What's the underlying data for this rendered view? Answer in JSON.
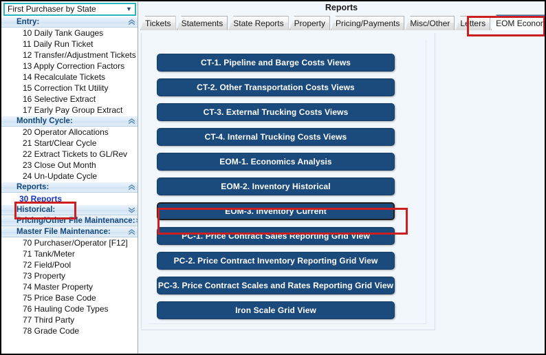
{
  "window": {
    "title": "Reports"
  },
  "sidebar": {
    "combo": {
      "value": "First Purchaser by State",
      "caret_icon": "chevron-down-icon"
    },
    "sections": [
      {
        "label": "Entry:",
        "expanded": true,
        "chevron_icon": "chevron-up-double-icon",
        "items": [
          "10 Daily Tank Gauges",
          "11 Daily Run Ticket",
          "12 Transfer/Adjustment Tickets",
          "13 Apply Correction Factors",
          "14 Recalculate Tickets",
          "15 Correction Tkt Utility",
          "16 Selective Extract",
          "17 Early Pay Group Extract"
        ]
      },
      {
        "label": "Monthly Cycle:",
        "expanded": true,
        "chevron_icon": "chevron-up-double-icon",
        "items": [
          "20 Operator Allocations",
          "21 Start/Clear Cycle",
          "22 Extract Tickets to GL/Rev",
          "23 Close Out Month",
          "24 Un-Update Cycle"
        ]
      },
      {
        "label": "Reports:",
        "expanded": true,
        "chevron_icon": "chevron-up-double-icon",
        "items": [],
        "link": "30 Reports"
      },
      {
        "label": "Historical:",
        "expanded": false,
        "chevron_icon": "chevron-down-double-icon",
        "items": []
      },
      {
        "label": "Pricing/Other File Maintenance:",
        "expanded": false,
        "chevron_icon": "chevron-down-double-icon",
        "items": []
      },
      {
        "label": "Master File Maintenance:",
        "expanded": true,
        "chevron_icon": "chevron-up-double-icon",
        "items": [
          "70 Purchaser/Operator  [F12]",
          "71 Tank/Meter",
          "72 Field/Pool",
          "73 Property",
          "74 Master Property",
          "75 Price Base Code",
          "76 Hauling Code Types",
          "77 Third Party",
          "78 Grade Code"
        ]
      }
    ]
  },
  "tabs": [
    {
      "label": "Tickets",
      "active": false
    },
    {
      "label": "Statements",
      "active": false
    },
    {
      "label": "State Reports",
      "active": false
    },
    {
      "label": "Property",
      "active": false
    },
    {
      "label": "Pricing/Payments",
      "active": false
    },
    {
      "label": "Misc/Other",
      "active": false
    },
    {
      "label": "Letters",
      "active": false
    },
    {
      "label": "EOM Economics",
      "active": true
    }
  ],
  "buttons": [
    {
      "label": "CT-1. Pipeline and Barge Costs Views",
      "focused": false
    },
    {
      "label": "CT-2. Other Transportation Costs Views",
      "focused": false
    },
    {
      "label": "CT-3. External Trucking Costs Views",
      "focused": false
    },
    {
      "label": "CT-4. Internal Trucking Costs Views",
      "focused": false
    },
    {
      "label": "EOM-1. Economics Analysis",
      "focused": false
    },
    {
      "label": "EOM-2. Inventory Historical",
      "focused": false
    },
    {
      "label": "EOM-3. Inventory Current",
      "focused": true
    },
    {
      "label": "PC-1. Price Contract Sales Reporting Grid View",
      "focused": false
    },
    {
      "label": "PC-2. Price Contract Inventory Reporting Grid View",
      "focused": false
    },
    {
      "label": "PC-3. Price Contract Scales and Rates Reporting Grid View",
      "focused": false
    },
    {
      "label": "Iron Scale Grid View",
      "focused": false
    }
  ],
  "annotations": {
    "highlight_color": "#cc1f1f",
    "boxes": [
      "30 Reports",
      "EOM Economics",
      "EOM-3. Inventory Current"
    ]
  },
  "colors": {
    "button_navy": "#1b4a7c",
    "link_blue": "#1733c4",
    "section_header_text": "#16477a",
    "combo_focus_border": "#27b6c0",
    "tab_accent": "#2f7fd0",
    "page_background": "#f1f7fb"
  }
}
